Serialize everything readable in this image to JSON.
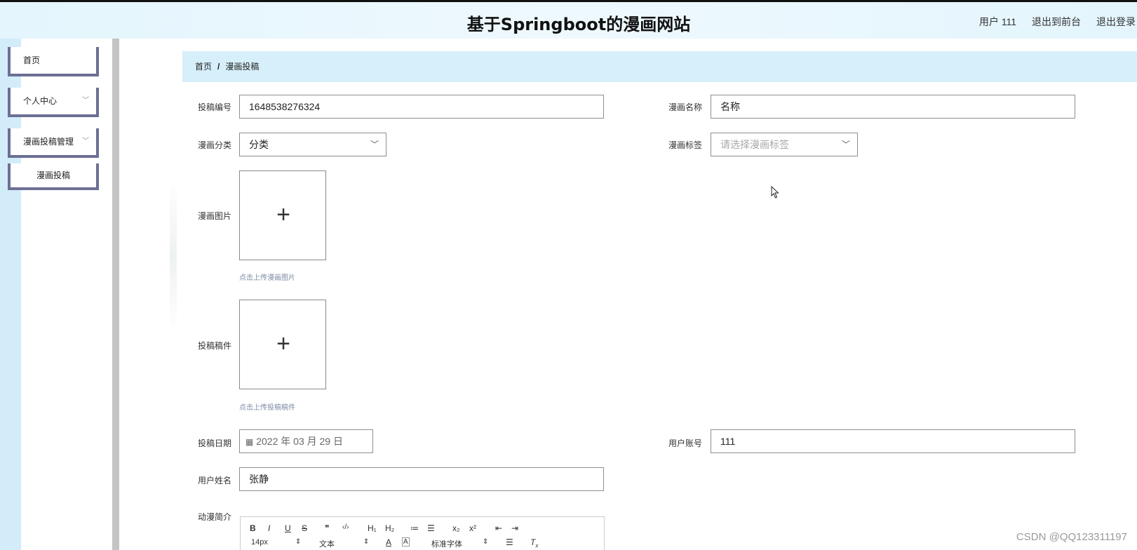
{
  "header": {
    "title": "基于Springboot的漫画网站",
    "user": "用户 111",
    "to_front": "退出到前台",
    "logout": "退出登录"
  },
  "sidebar": {
    "items": [
      {
        "label": "首页"
      },
      {
        "label": "个人中心"
      },
      {
        "label": "漫画投稿管理"
      },
      {
        "label": "漫画投稿"
      }
    ]
  },
  "breadcrumb": {
    "home": "首页",
    "sep": "/",
    "current": "漫画投稿"
  },
  "form": {
    "submission_no": {
      "label": "投稿编号",
      "value": "1648538276324"
    },
    "comic_name": {
      "label": "漫画名称",
      "value": "名称"
    },
    "category": {
      "label": "漫画分类",
      "value": "分类"
    },
    "tags": {
      "label": "漫画标签",
      "placeholder": "请选择漫画标签"
    },
    "image": {
      "label": "漫画图片",
      "hint": "点击上传漫画图片"
    },
    "manuscript": {
      "label": "投稿稿件",
      "hint": "点击上传投稿稿件"
    },
    "date": {
      "label": "投稿日期",
      "value": "2022 年 03 月 29 日"
    },
    "account": {
      "label": "用户账号",
      "value": "111"
    },
    "name": {
      "label": "用户姓名",
      "value": "张静"
    },
    "intro": {
      "label": "动漫简介"
    }
  },
  "editor": {
    "row1": [
      "B",
      "I",
      "U",
      "S",
      "❞",
      "‹/›",
      "H₁",
      "H₂",
      "≔",
      "☰",
      "x₂",
      "x²",
      "⇤",
      "⇥"
    ],
    "font_size": "14px",
    "block": "文本",
    "font": "标准字体"
  },
  "watermark": "CSDN @QQ123311197"
}
